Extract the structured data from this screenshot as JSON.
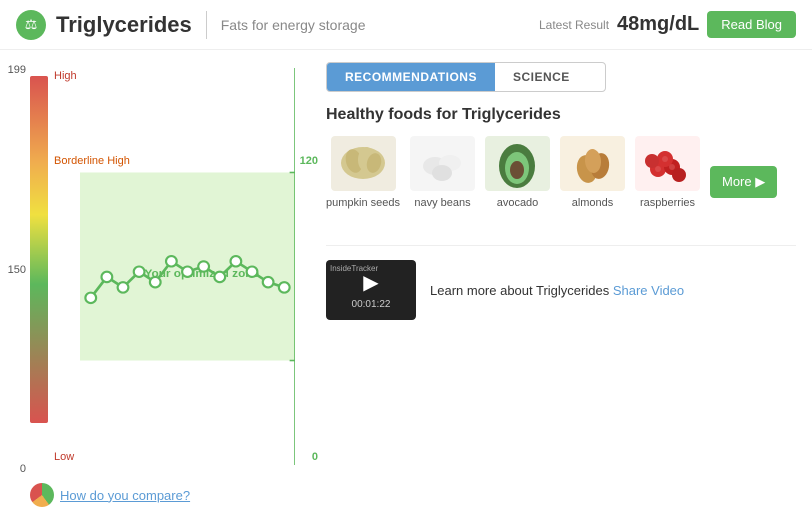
{
  "header": {
    "title": "Triglycerides",
    "subtitle": "Fats for energy storage",
    "latest_label": "Latest Result",
    "latest_value": "48mg/dL",
    "read_blog": "Read Blog"
  },
  "chart": {
    "y_labels": [
      "199",
      "150",
      "0"
    ],
    "zone_high": "High",
    "zone_borderline": "Borderline High",
    "zone_low": "Low",
    "zone_optimized": "Your optimized zone",
    "right_labels": [
      "120",
      "0"
    ]
  },
  "tabs": [
    {
      "label": "RECOMMENDATIONS",
      "active": true
    },
    {
      "label": "SCIENCE",
      "active": false
    }
  ],
  "section_title": "Healthy foods for Triglycerides",
  "foods": [
    {
      "label": "pumpkin seeds",
      "emoji": "🌰"
    },
    {
      "label": "navy beans",
      "emoji": "🫘"
    },
    {
      "label": "avocado",
      "emoji": "🥑"
    },
    {
      "label": "almonds",
      "emoji": "🌰"
    },
    {
      "label": "raspberries",
      "emoji": "🫐"
    }
  ],
  "more_btn": "More ▶",
  "video": {
    "duration": "00:01:22",
    "watermark": "InsideTracker",
    "text": "Learn more about Triglycerides",
    "share_label": "Share Video"
  },
  "compare": {
    "link_text": "How do you compare?"
  }
}
